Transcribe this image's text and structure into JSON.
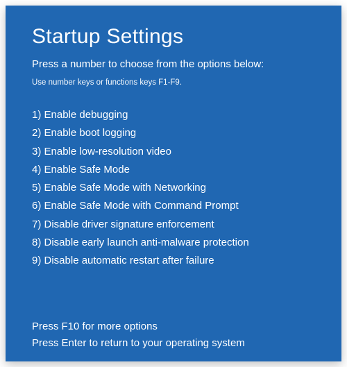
{
  "title": "Startup Settings",
  "instruction": "Press a number to choose from the options below:",
  "sub_instruction": "Use number keys or functions keys F1-F9.",
  "options": [
    {
      "num": "1)",
      "label": "Enable debugging"
    },
    {
      "num": "2)",
      "label": "Enable boot logging"
    },
    {
      "num": "3)",
      "label": "Enable low-resolution video"
    },
    {
      "num": "4)",
      "label": "Enable Safe Mode"
    },
    {
      "num": "5)",
      "label": "Enable Safe Mode with Networking"
    },
    {
      "num": "6)",
      "label": "Enable Safe Mode with Command Prompt"
    },
    {
      "num": "7)",
      "label": "Disable driver signature enforcement"
    },
    {
      "num": "8)",
      "label": "Disable early launch anti-malware protection"
    },
    {
      "num": "9)",
      "label": "Disable automatic restart after failure"
    }
  ],
  "footer": {
    "more": "Press F10 for more options",
    "return": "Press Enter to return to your operating system"
  }
}
